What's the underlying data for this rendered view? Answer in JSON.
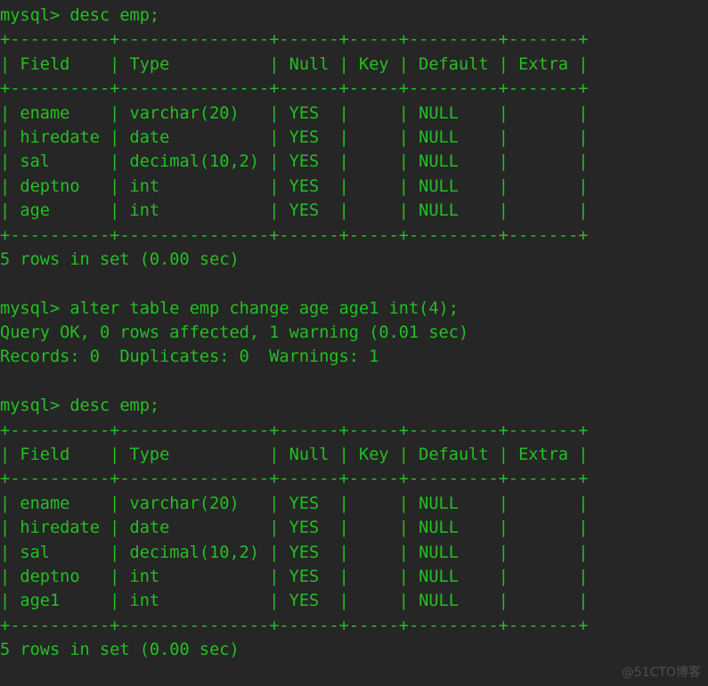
{
  "terminal": {
    "foreground_color": "#22c022",
    "background_color": "#262626",
    "watermark": "@51CTO博客",
    "watermark_color": "#555555",
    "lines": [
      "mysql> desc emp;",
      "+----------+---------------+------+-----+---------+-------+",
      "| Field    | Type          | Null | Key | Default | Extra |",
      "+----------+---------------+------+-----+---------+-------+",
      "| ename    | varchar(20)   | YES  |     | NULL    |       |",
      "| hiredate | date          | YES  |     | NULL    |       |",
      "| sal      | decimal(10,2) | YES  |     | NULL    |       |",
      "| deptno   | int           | YES  |     | NULL    |       |",
      "| age      | int           | YES  |     | NULL    |       |",
      "+----------+---------------+------+-----+---------+-------+",
      "5 rows in set (0.00 sec)",
      "",
      "mysql> alter table emp change age age1 int(4);",
      "Query OK, 0 rows affected, 1 warning (0.01 sec)",
      "Records: 0  Duplicates: 0  Warnings: 1",
      "",
      "mysql> desc emp;",
      "+----------+---------------+------+-----+---------+-------+",
      "| Field    | Type          | Null | Key | Default | Extra |",
      "+----------+---------------+------+-----+---------+-------+",
      "| ename    | varchar(20)   | YES  |     | NULL    |       |",
      "| hiredate | date          | YES  |     | NULL    |       |",
      "| sal      | decimal(10,2) | YES  |     | NULL    |       |",
      "| deptno   | int           | YES  |     | NULL    |       |",
      "| age1     | int           | YES  |     | NULL    |       |",
      "+----------+---------------+------+-----+---------+-------+",
      "5 rows in set (0.00 sec)"
    ]
  }
}
